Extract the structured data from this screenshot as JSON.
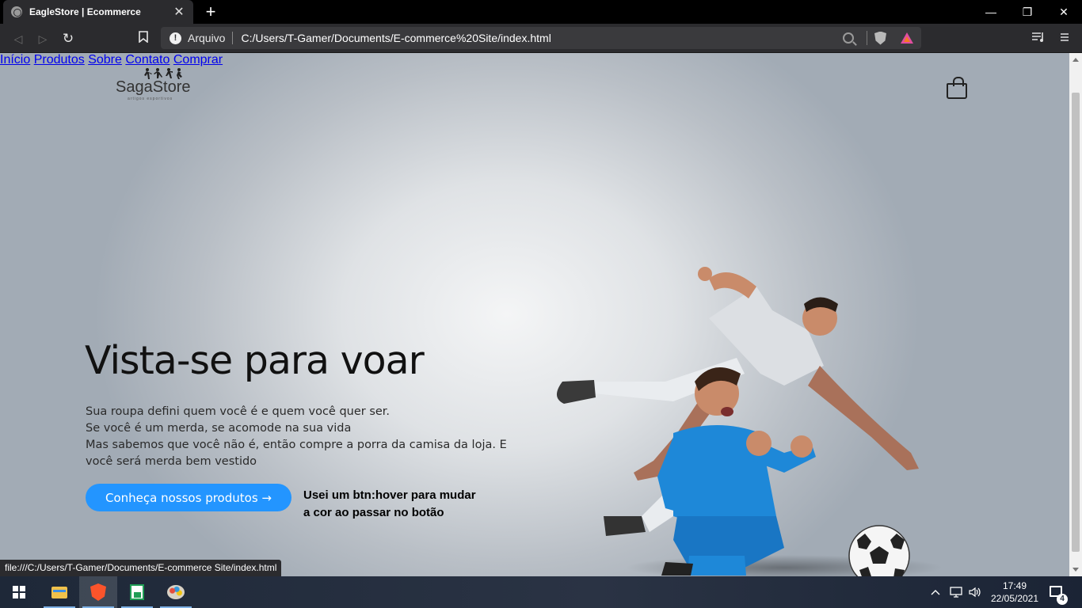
{
  "browser": {
    "tab_title": "EagleStore | Ecommerce",
    "tab_close": "✕",
    "new_tab": "+",
    "window_controls": {
      "minimize": "—",
      "maximize": "❐",
      "close": "✕"
    },
    "url_label": "Arquivo",
    "url": "C:/Users/T-Gamer/Documents/E-commerce%20Site/index.html",
    "status_url": "file:///C:/Users/T-Gamer/Documents/E-commerce Site/index.html"
  },
  "site": {
    "logo": {
      "name_part1": "Saga",
      "name_part2": "Store",
      "tagline": "artigos esportivos"
    },
    "nav": [
      "Início",
      "Produtos",
      "Sobre",
      "Contato",
      "Comprar"
    ],
    "hero": {
      "title": "Vista-se para voar",
      "lines": [
        "Sua roupa defini quem você é e quem você quer ser.",
        "Se você é um merda, se acomode na sua vida",
        "Mas sabemos que você não é, então compre a porra da camisa da loja. E você será merda bem vestido"
      ],
      "cta_label": "Conheça nossos produtos →",
      "cta_color": "#2395ff",
      "note": "Usei um btn:hover para mudar a cor ao passar no botão"
    },
    "colors": {
      "jersey_blue": "#1e88d8",
      "jersey_white": "#e9ecef"
    }
  },
  "taskbar": {
    "time": "17:49",
    "date": "22/05/2021",
    "notification_count": "4",
    "apps": [
      "windows-start",
      "file-explorer",
      "brave-browser",
      "spreadsheet-app",
      "paint-app"
    ]
  }
}
